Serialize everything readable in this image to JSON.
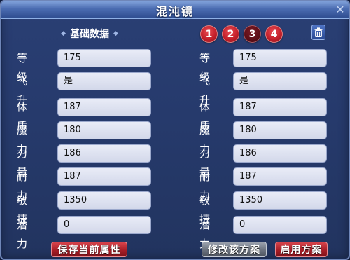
{
  "window": {
    "title": "混沌镜",
    "close_label": "✕"
  },
  "section": {
    "title": "基础数据",
    "deco": "◆"
  },
  "plan_tabs": [
    {
      "label": "1",
      "active": false
    },
    {
      "label": "2",
      "active": false
    },
    {
      "label": "3",
      "active": true
    },
    {
      "label": "4",
      "active": false
    }
  ],
  "left": {
    "rows": [
      {
        "label": "等级",
        "value": "175"
      },
      {
        "label": "飞升",
        "value": "是"
      },
      {
        "label": "体质",
        "value": "187"
      },
      {
        "label": "魔力",
        "value": "180"
      },
      {
        "label": "力量",
        "value": "186"
      },
      {
        "label": "耐力",
        "value": "187"
      },
      {
        "label": "敏捷",
        "value": "1350"
      },
      {
        "label": "潜力",
        "value": "0"
      }
    ]
  },
  "right": {
    "rows": [
      {
        "label": "等级",
        "value": "175"
      },
      {
        "label": "飞升",
        "value": "是"
      },
      {
        "label": "体质",
        "value": "187"
      },
      {
        "label": "魔力",
        "value": "180"
      },
      {
        "label": "力量",
        "value": "186"
      },
      {
        "label": "耐力",
        "value": "187"
      },
      {
        "label": "敏捷",
        "value": "1350"
      },
      {
        "label": "潜力",
        "value": "0"
      }
    ]
  },
  "buttons": {
    "save_current": "保存当前属性",
    "modify_plan": "修改该方案",
    "apply_plan": "启用方案"
  },
  "colors": {
    "accent_red": "#c4202b",
    "active_tab": "#5c0e17",
    "panel": "#263a6c"
  },
  "icons": {
    "close": "close-icon",
    "trash": "trash-icon"
  }
}
